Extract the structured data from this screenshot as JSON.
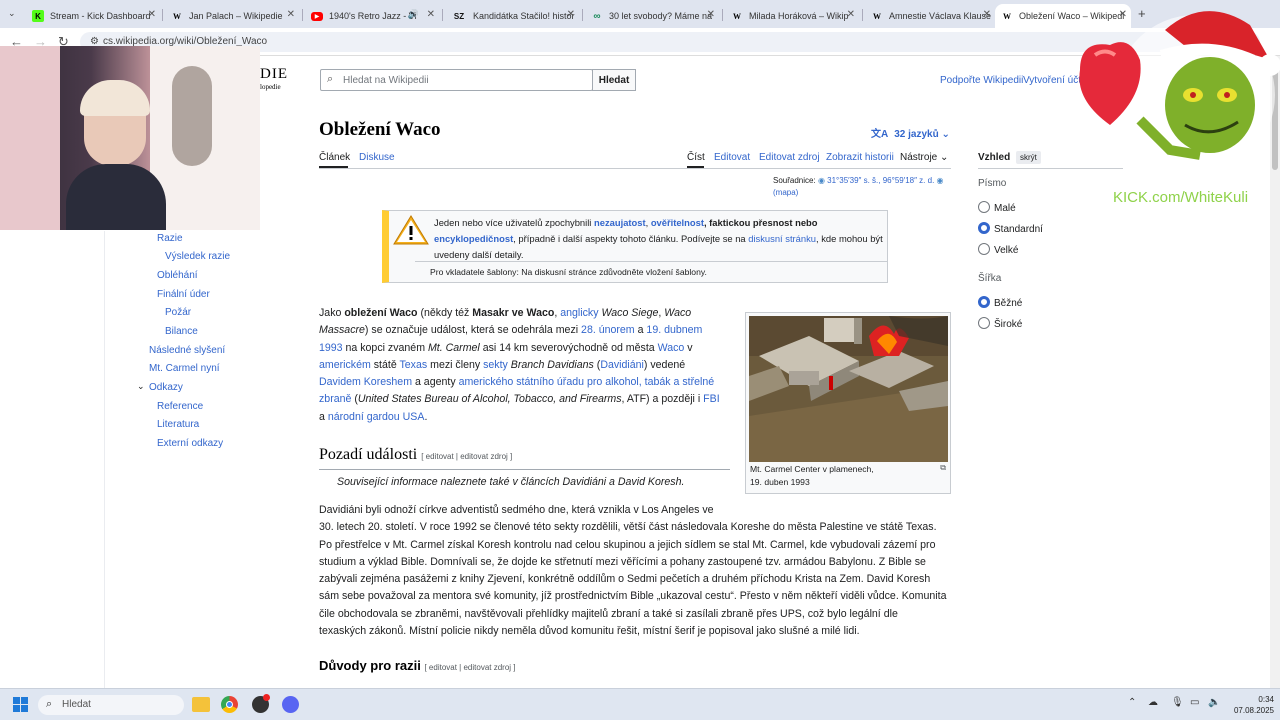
{
  "browser": {
    "tabs": [
      {
        "title": "Stream - Kick Dashboard",
        "icon": "kick-icon"
      },
      {
        "title": "Jan Palach – Wikipedie",
        "icon": "wikipedia-icon"
      },
      {
        "title": "1940's Retro Jazz - Vi",
        "icon": "youtube-icon"
      },
      {
        "title": "Kandidátka Stačilo! histor",
        "icon": "sz-icon"
      },
      {
        "title": "30 let svobody? Máme na",
        "icon": "link-icon"
      },
      {
        "title": "Milada Horáková – Wikip",
        "icon": "wikipedia-icon"
      },
      {
        "title": "Amnestie Václava Klause",
        "icon": "wikipedia-icon"
      },
      {
        "title": "Obležení Waco – Wikipedi",
        "icon": "wikipedia-icon"
      }
    ],
    "url": "cs.wikipedia.org/wiki/Obležení_Waco"
  },
  "wiki": {
    "logo_fragment": "DIE",
    "logo_sub": "lopedie",
    "search_placeholder": "Hledat na Wikipedii",
    "search_button": "Hledat",
    "top_links": [
      "Podpořte Wikipedii",
      "Vytvoření účtu"
    ],
    "title": "Obležení Waco",
    "languages": "32 jazyků",
    "page_tabs": [
      "Článek",
      "Diskuse"
    ],
    "view_tabs": [
      "Číst",
      "Editovat",
      "Editovat zdroj",
      "Zobrazit historii",
      "Nástroje"
    ],
    "coordinates_label": "Souřadnice:",
    "coordinates": "31°35′39″ s. š., 96°59′18″ z. d.",
    "map_link": "(mapa)",
    "notice": {
      "p1": "Jeden nebo více uživatelů zpochybnili",
      "l1": "nezaujatost",
      "l2": "ověřitelnost",
      "p2": ", faktickou přesnost nebo",
      "l3": "encyklopedičnost",
      "p3": ", případně i další aspekty tohoto článku. Podívejte se na",
      "l4": "diskusní stránku",
      "p4": ", kde mohou být uvedeny další detaily.",
      "sub": "Pro vkladatele šablony: Na diskusní stránce zdůvodněte vložení šablony."
    },
    "toc": [
      "Razie",
      "Výsledek razie",
      "Obléhání",
      "Finální úder",
      "Požár",
      "Bilance",
      "Následné slyšení",
      "Mt. Carmel nyní",
      "Odkazy",
      "Reference",
      "Literatura",
      "Externí odkazy"
    ],
    "intro": {
      "line1": "Jako obležení Waco (někdy též Masakr ve Waco, anglicky Waco Siege, Waco",
      "line2": "Massacre) se označuje událost, která se odehrála mezi 28. únorem a 19. dubnem",
      "line3": "1993 na kopci zvaném Mt. Carmel asi 14 km severovýchodně od města Waco v",
      "line4": "americkém státě Texas mezi členy sekty Branch Davidians (Davidiáni) vedené",
      "line5": "Davidem Koreshem a agenty amerického státního úřadu pro alkohol, tabák a střelné",
      "line6": "zbraně (United States Bureau of Alcohol, Tobacco, and Firearms, ATF) a později i FBI",
      "line7": "a národní gardou USA."
    },
    "section1": {
      "title": "Pozadí události",
      "edit": "[ editovat | editovat zdroj ]",
      "hatnote": "Související informace naleznete také v článcích Davidiáni a David Koresh.",
      "lines": [
        "Davidiáni byli odnoží církve adventistů sedmého dne, která vznikla v Los Angeles ve",
        "30. letech 20. století. V roce 1992 se členové této sekty rozdělili, větší část následovala Koreshe do města Palestine ve státě Texas.",
        "Po přestřelce v Mt. Carmel získal Koresh kontrolu nad celou skupinou a jejich sídlem se stal Mt. Carmel, kde vybudovali zázemí pro",
        "studium a výklad Bible. Domnívali se, že dojde ke střetnutí mezi věřícími a pohany zastoupené tzv. armádou Babylonu. Z Bible se",
        "zabývali zejména pasážemi z knihy Zjevení, konkrétně oddílům o Sedmi pečetích a druhém příchodu Krista na Zem. David Koresh",
        "sám sebe považoval za mentora své komunity, jíž prostřednictvím Bible „ukazoval cestu“. Přesto v něm někteří viděli vůdce. Komunita",
        "čile obchodovala se zbraněmi, navštěvovali přehlídky majitelů zbraní a také si zasílali zbraně přes UPS, což bylo legální dle",
        "texaských zákonů. Místní policie nikdy neměla důvod komunitu řešit, místní šerif je popisoval jako slušné a milé lidi."
      ]
    },
    "section2": {
      "title": "Důvody pro razii",
      "edit": "[ editovat | editovat zdroj ]"
    },
    "figure_caption_1": "Mt. Carmel Center v plamenech,",
    "figure_caption_2": "19. duben 1993",
    "appearance": {
      "title": "Vzhled",
      "hide": "skrýt",
      "font_label": "Písmo",
      "font_options": [
        "Malé",
        "Standardní",
        "Velké"
      ],
      "width_label": "Šířka",
      "width_options": [
        "Běžné",
        "Široké"
      ]
    }
  },
  "overlay": {
    "kick_text": "KICK.com/WhiteKuli"
  },
  "taskbar": {
    "search_placeholder": "Hledat",
    "time": "0:34",
    "date": "07.08.2025"
  }
}
